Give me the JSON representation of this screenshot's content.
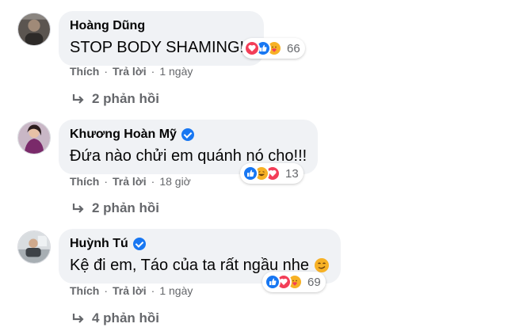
{
  "comments": [
    {
      "author": "Hoàng Dũng",
      "text": "STOP BODY SHAMING!!!",
      "verified": false,
      "reactions": [
        "love",
        "like",
        "care"
      ],
      "reaction_count": "66",
      "actions": {
        "like": "Thích",
        "reply": "Trả lời",
        "time": "1 ngày"
      },
      "replies": "2 phản hồi"
    },
    {
      "author": "Khương Hoàn Mỹ",
      "text": "Đứa nào chửi em quánh nó cho!!!",
      "verified": true,
      "reactions": [
        "like",
        "haha",
        "love"
      ],
      "reaction_count": "13",
      "actions": {
        "like": "Thích",
        "reply": "Trả lời",
        "time": "18 giờ"
      },
      "replies": "2 phản hồi"
    },
    {
      "author": "Huỳnh Tú",
      "text": "Kệ đi em, Táo của ta rất ngầu nhe",
      "emoji": "smirk-emoji",
      "verified": true,
      "reactions": [
        "like",
        "love",
        "care"
      ],
      "reaction_count": "69",
      "actions": {
        "like": "Thích",
        "reply": "Trả lời",
        "time": "1 ngày"
      },
      "replies": "4 phản hồi"
    }
  ],
  "colors": {
    "bubble": "#f0f2f5",
    "secondary_text": "#65676b",
    "like_blue": "#1877f2",
    "love_red": "#f33e58",
    "haha_yellow": "#f7b125"
  }
}
